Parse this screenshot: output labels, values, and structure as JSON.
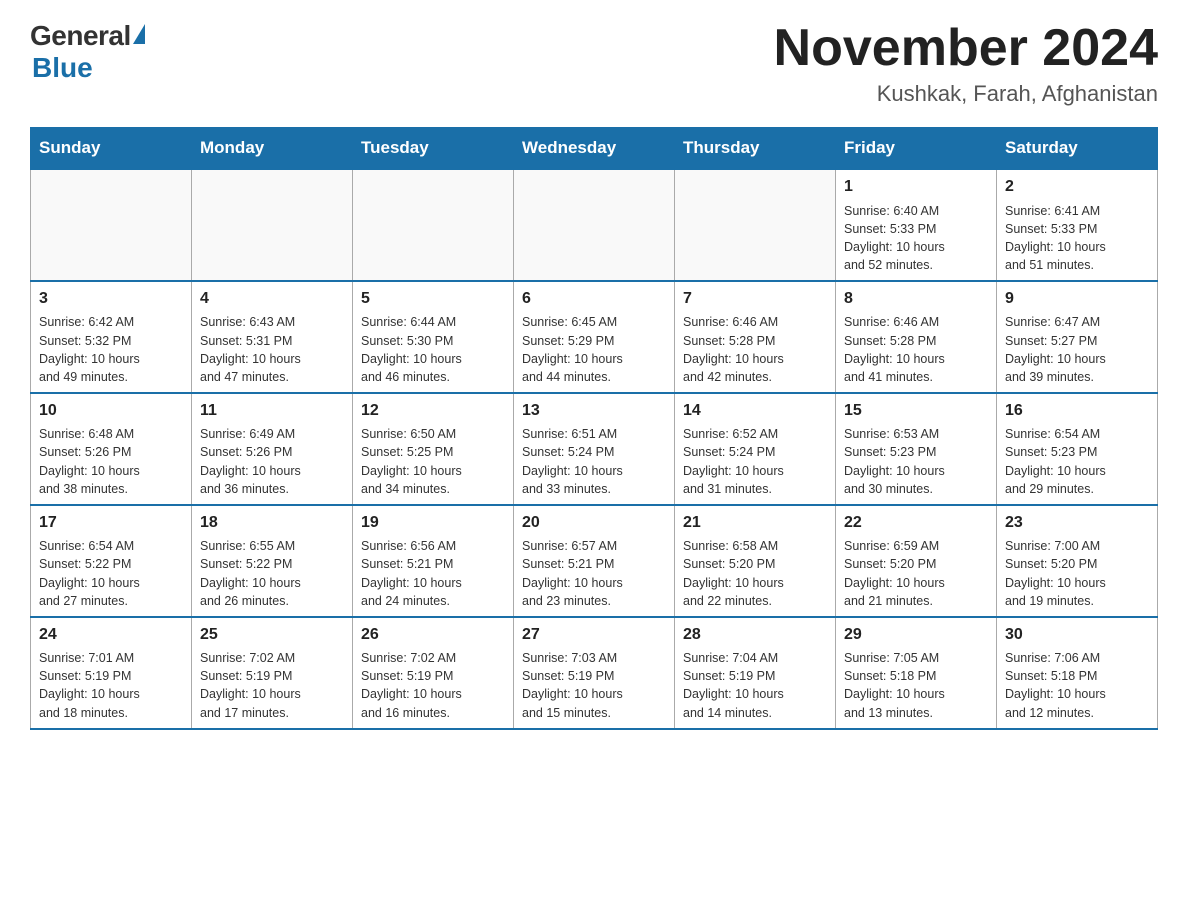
{
  "logo": {
    "general": "General",
    "blue": "Blue"
  },
  "title": {
    "month": "November 2024",
    "location": "Kushkak, Farah, Afghanistan"
  },
  "days_of_week": [
    "Sunday",
    "Monday",
    "Tuesday",
    "Wednesday",
    "Thursday",
    "Friday",
    "Saturday"
  ],
  "weeks": [
    [
      {
        "day": "",
        "info": ""
      },
      {
        "day": "",
        "info": ""
      },
      {
        "day": "",
        "info": ""
      },
      {
        "day": "",
        "info": ""
      },
      {
        "day": "",
        "info": ""
      },
      {
        "day": "1",
        "info": "Sunrise: 6:40 AM\nSunset: 5:33 PM\nDaylight: 10 hours\nand 52 minutes."
      },
      {
        "day": "2",
        "info": "Sunrise: 6:41 AM\nSunset: 5:33 PM\nDaylight: 10 hours\nand 51 minutes."
      }
    ],
    [
      {
        "day": "3",
        "info": "Sunrise: 6:42 AM\nSunset: 5:32 PM\nDaylight: 10 hours\nand 49 minutes."
      },
      {
        "day": "4",
        "info": "Sunrise: 6:43 AM\nSunset: 5:31 PM\nDaylight: 10 hours\nand 47 minutes."
      },
      {
        "day": "5",
        "info": "Sunrise: 6:44 AM\nSunset: 5:30 PM\nDaylight: 10 hours\nand 46 minutes."
      },
      {
        "day": "6",
        "info": "Sunrise: 6:45 AM\nSunset: 5:29 PM\nDaylight: 10 hours\nand 44 minutes."
      },
      {
        "day": "7",
        "info": "Sunrise: 6:46 AM\nSunset: 5:28 PM\nDaylight: 10 hours\nand 42 minutes."
      },
      {
        "day": "8",
        "info": "Sunrise: 6:46 AM\nSunset: 5:28 PM\nDaylight: 10 hours\nand 41 minutes."
      },
      {
        "day": "9",
        "info": "Sunrise: 6:47 AM\nSunset: 5:27 PM\nDaylight: 10 hours\nand 39 minutes."
      }
    ],
    [
      {
        "day": "10",
        "info": "Sunrise: 6:48 AM\nSunset: 5:26 PM\nDaylight: 10 hours\nand 38 minutes."
      },
      {
        "day": "11",
        "info": "Sunrise: 6:49 AM\nSunset: 5:26 PM\nDaylight: 10 hours\nand 36 minutes."
      },
      {
        "day": "12",
        "info": "Sunrise: 6:50 AM\nSunset: 5:25 PM\nDaylight: 10 hours\nand 34 minutes."
      },
      {
        "day": "13",
        "info": "Sunrise: 6:51 AM\nSunset: 5:24 PM\nDaylight: 10 hours\nand 33 minutes."
      },
      {
        "day": "14",
        "info": "Sunrise: 6:52 AM\nSunset: 5:24 PM\nDaylight: 10 hours\nand 31 minutes."
      },
      {
        "day": "15",
        "info": "Sunrise: 6:53 AM\nSunset: 5:23 PM\nDaylight: 10 hours\nand 30 minutes."
      },
      {
        "day": "16",
        "info": "Sunrise: 6:54 AM\nSunset: 5:23 PM\nDaylight: 10 hours\nand 29 minutes."
      }
    ],
    [
      {
        "day": "17",
        "info": "Sunrise: 6:54 AM\nSunset: 5:22 PM\nDaylight: 10 hours\nand 27 minutes."
      },
      {
        "day": "18",
        "info": "Sunrise: 6:55 AM\nSunset: 5:22 PM\nDaylight: 10 hours\nand 26 minutes."
      },
      {
        "day": "19",
        "info": "Sunrise: 6:56 AM\nSunset: 5:21 PM\nDaylight: 10 hours\nand 24 minutes."
      },
      {
        "day": "20",
        "info": "Sunrise: 6:57 AM\nSunset: 5:21 PM\nDaylight: 10 hours\nand 23 minutes."
      },
      {
        "day": "21",
        "info": "Sunrise: 6:58 AM\nSunset: 5:20 PM\nDaylight: 10 hours\nand 22 minutes."
      },
      {
        "day": "22",
        "info": "Sunrise: 6:59 AM\nSunset: 5:20 PM\nDaylight: 10 hours\nand 21 minutes."
      },
      {
        "day": "23",
        "info": "Sunrise: 7:00 AM\nSunset: 5:20 PM\nDaylight: 10 hours\nand 19 minutes."
      }
    ],
    [
      {
        "day": "24",
        "info": "Sunrise: 7:01 AM\nSunset: 5:19 PM\nDaylight: 10 hours\nand 18 minutes."
      },
      {
        "day": "25",
        "info": "Sunrise: 7:02 AM\nSunset: 5:19 PM\nDaylight: 10 hours\nand 17 minutes."
      },
      {
        "day": "26",
        "info": "Sunrise: 7:02 AM\nSunset: 5:19 PM\nDaylight: 10 hours\nand 16 minutes."
      },
      {
        "day": "27",
        "info": "Sunrise: 7:03 AM\nSunset: 5:19 PM\nDaylight: 10 hours\nand 15 minutes."
      },
      {
        "day": "28",
        "info": "Sunrise: 7:04 AM\nSunset: 5:19 PM\nDaylight: 10 hours\nand 14 minutes."
      },
      {
        "day": "29",
        "info": "Sunrise: 7:05 AM\nSunset: 5:18 PM\nDaylight: 10 hours\nand 13 minutes."
      },
      {
        "day": "30",
        "info": "Sunrise: 7:06 AM\nSunset: 5:18 PM\nDaylight: 10 hours\nand 12 minutes."
      }
    ]
  ]
}
